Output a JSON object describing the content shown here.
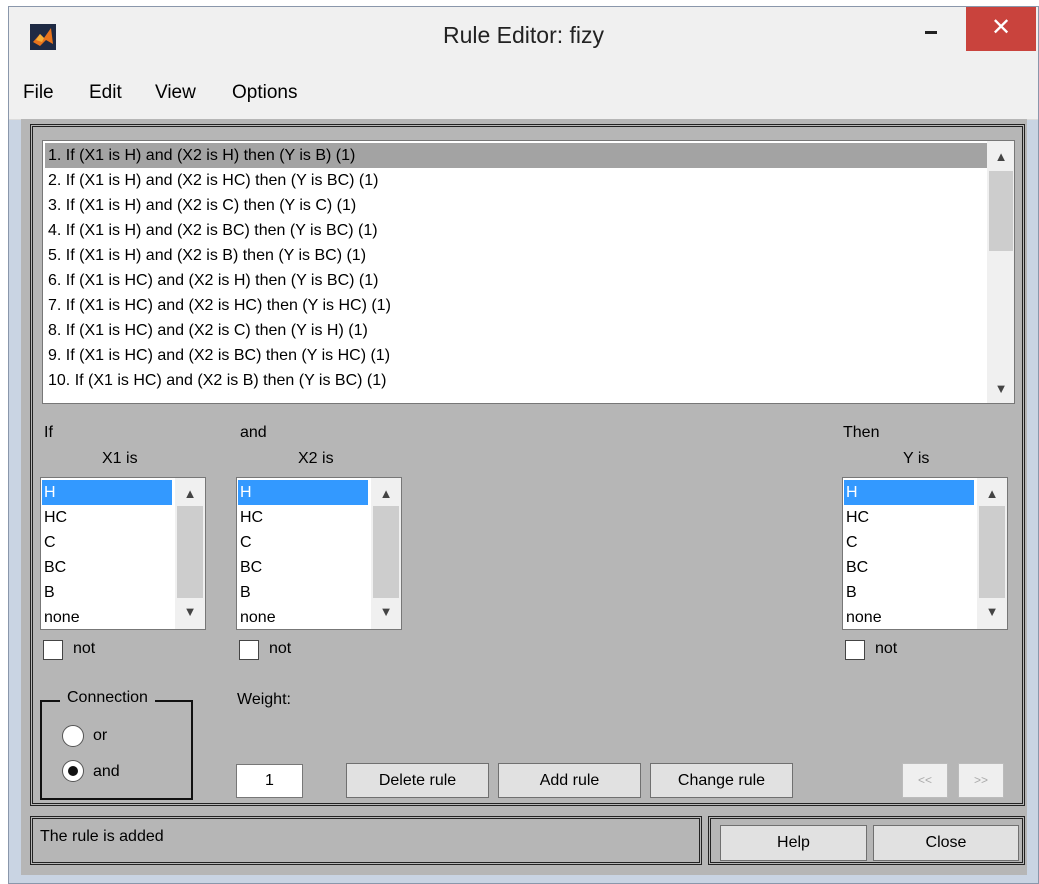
{
  "window": {
    "title": "Rule Editor: fizy",
    "close_glyph": "✕"
  },
  "menu": {
    "items": [
      "File",
      "Edit",
      "View",
      "Options"
    ]
  },
  "rules": {
    "items": [
      "1. If (X1 is H) and (X2 is H) then (Y is B) (1)",
      "2. If (X1 is H) and (X2 is HC) then (Y is BC) (1)",
      "3. If (X1 is H) and (X2 is C) then (Y is C) (1)",
      "4. If (X1 is H) and (X2 is BC) then (Y is BC) (1)",
      "5. If (X1 is H) and (X2 is B) then (Y is BC) (1)",
      "6. If (X1 is HC) and (X2 is H) then (Y is BC) (1)",
      "7. If (X1 is HC) and (X2 is HC) then (Y is HC) (1)",
      "8. If (X1 is HC) and (X2 is C) then (Y is H) (1)",
      "9. If (X1 is HC) and (X2 is BC) then (Y is HC) (1)",
      "10. If (X1 is HC) and (X2 is B) then (Y is BC) (1)"
    ],
    "selected_index": 0
  },
  "antecedent": {
    "if_label": "If",
    "and_label": "and",
    "x1": {
      "label": "X1 is",
      "options": [
        "H",
        "HC",
        "C",
        "BC",
        "B",
        "none"
      ],
      "selected": "H"
    },
    "x2": {
      "label": "X2 is",
      "options": [
        "H",
        "HC",
        "C",
        "BC",
        "B",
        "none"
      ],
      "selected": "H"
    }
  },
  "consequent": {
    "then_label": "Then",
    "y": {
      "label": "Y is",
      "options": [
        "H",
        "HC",
        "C",
        "BC",
        "B",
        "none"
      ],
      "selected": "H"
    }
  },
  "not_label": "not",
  "connection": {
    "title": "Connection",
    "options": [
      "or",
      "and"
    ],
    "selected": "and"
  },
  "weight": {
    "label": "Weight:",
    "value": "1"
  },
  "buttons": {
    "delete": "Delete rule",
    "add": "Add rule",
    "change": "Change rule",
    "prev": "<<",
    "next": ">>",
    "help": "Help",
    "close": "Close"
  },
  "status": "The rule is added",
  "colors": {
    "selection": "#3399ff",
    "close_button": "#c9433d",
    "panel": "#b6b6b6"
  }
}
